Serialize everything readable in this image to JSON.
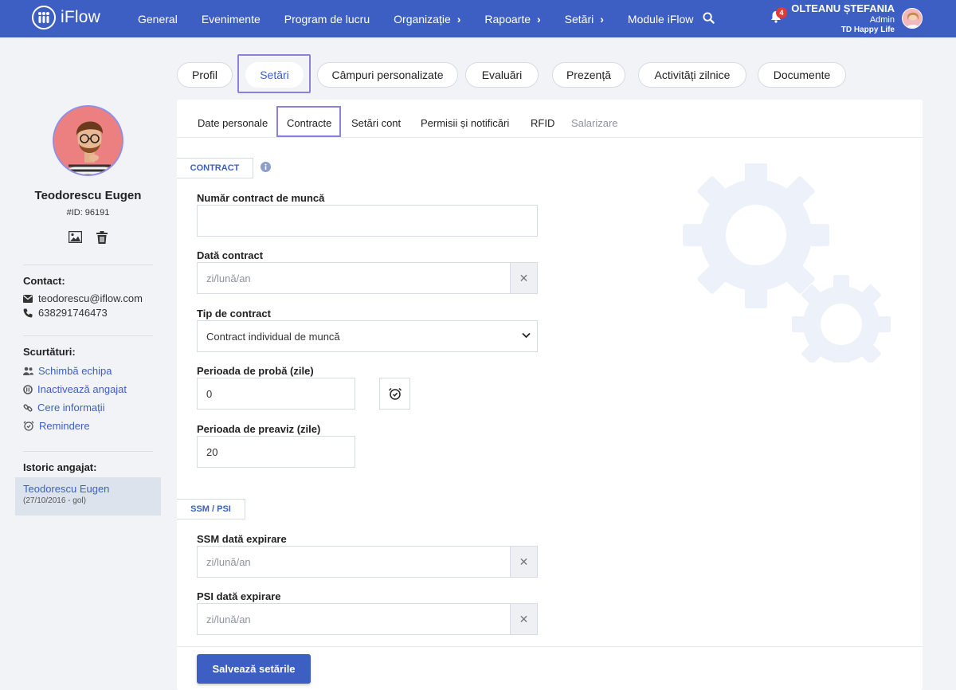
{
  "app": {
    "logo_text": "iFlow"
  },
  "nav": {
    "items": [
      {
        "label": "General",
        "has_arrow": false
      },
      {
        "label": "Evenimente",
        "has_arrow": false
      },
      {
        "label": "Program de lucru",
        "has_arrow": false
      },
      {
        "label": "Organizație",
        "has_arrow": true
      },
      {
        "label": "Rapoarte",
        "has_arrow": true
      },
      {
        "label": "Setări",
        "has_arrow": true
      },
      {
        "label": "Module iFlow",
        "has_arrow": false
      }
    ],
    "arrow": "›",
    "notifications_count": "4"
  },
  "user": {
    "name": "OLTEANU ȘTEFANIA",
    "role": "Admin",
    "company": "TD Happy Life"
  },
  "profile_tabs": [
    "Profil",
    "Setări",
    "Câmpuri personalizate",
    "Evaluări",
    "Prezență",
    "Activități zilnice",
    "Documente"
  ],
  "active_profile_tab": "Setări",
  "employee": {
    "name": "Teodorescu Eugen",
    "id_text": "#ID: 96191",
    "contact_title": "Contact:",
    "email": "teodorescu@iflow.com",
    "phone": "638291746473",
    "shortcuts_title": "Scurtături:",
    "shortcuts": [
      "Schimbă echipa",
      "Inactivează angajat",
      "Cere informații",
      "Remindere"
    ],
    "history_title": "Istoric angajat:",
    "history": {
      "name": "Teodorescu Eugen",
      "period": "(27/10/2016 - gol)"
    }
  },
  "sub_tabs": [
    "Date personale",
    "Contracte",
    "Setări cont",
    "Permisii și notificări",
    "RFID",
    "Salarizare"
  ],
  "active_sub_tab": "Contracte",
  "form": {
    "contract_section": "CONTRACT",
    "contract_number_label": "Număr contract de muncă",
    "contract_number_value": "",
    "contract_date_label": "Dată contract",
    "contract_date_placeholder": "zi/lună/an",
    "contract_type_label": "Tip de contract",
    "contract_type_value": "Contract individual de muncă",
    "probation_label": "Perioada de probă (zile)",
    "probation_value": "0",
    "notice_label": "Perioada de preaviz (zile)",
    "notice_value": "20",
    "ssm_section": "SSM / PSI",
    "ssm_label": "SSM dată expirare",
    "ssm_placeholder": "zi/lună/an",
    "psi_label": "PSI dată expirare",
    "psi_placeholder": "zi/lună/an",
    "clear_symbol": "✕",
    "save_label": "Salvează setările"
  },
  "colors": {
    "brand": "#3d5fc4",
    "highlight": "#8a80e0",
    "badge": "#e53935"
  }
}
